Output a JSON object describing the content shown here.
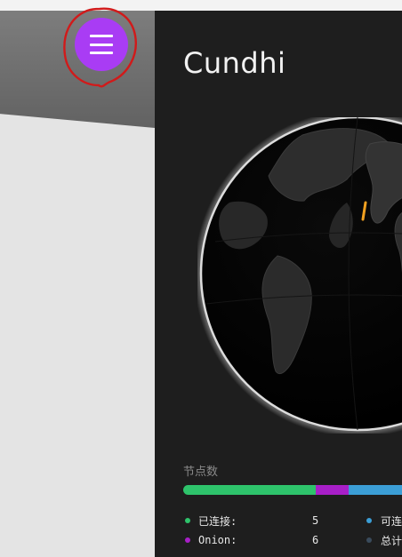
{
  "app": {
    "title": "Cundhi"
  },
  "menu_button": {
    "icon": "hamburger-menu-icon",
    "color": "#a93cf4"
  },
  "stats": {
    "label": "节点数",
    "bar": [
      {
        "name": "connected",
        "fraction": 0.67,
        "color": "#2ec36b"
      },
      {
        "name": "onion",
        "fraction": 0.14,
        "color": "#a81fc8"
      },
      {
        "name": "reachable",
        "fraction": 0.19,
        "color": "#3b9ed6"
      }
    ],
    "legend_left": [
      {
        "label": "已连接:",
        "count": "5",
        "color": "#2ec36b"
      },
      {
        "label": "Onion:",
        "count": "6",
        "color": "#a81fc8"
      }
    ],
    "legend_right": [
      {
        "label": "可连",
        "color": "#3b9ed6"
      },
      {
        "label": "总计",
        "color": "#3a4b5c"
      }
    ]
  },
  "colors": {
    "panel_bg": "#1e1e1e",
    "accent": "#a93cf4",
    "node_marker": "#f0a020"
  }
}
